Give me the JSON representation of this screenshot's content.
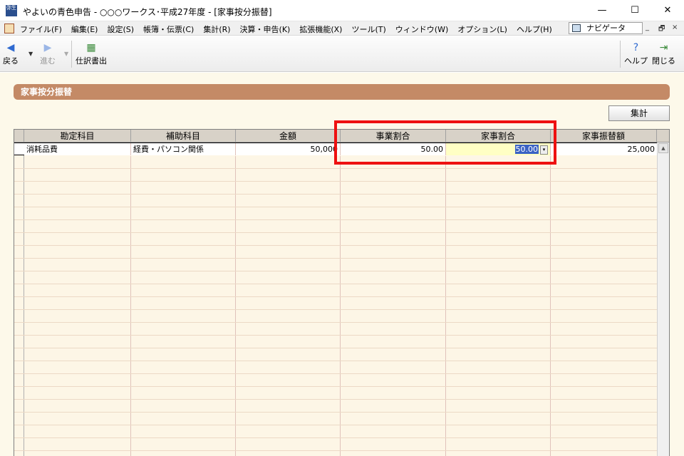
{
  "window": {
    "title": "やよいの青色申告 - ○○○ワークス･平成27年度 - [家事按分振替]",
    "app_icon_text": "弥生",
    "controls": {
      "minimize": "—",
      "maximize": "☐",
      "close": "✕"
    }
  },
  "menu": {
    "items": [
      "ファイル(F)",
      "編集(E)",
      "設定(S)",
      "帳簿・伝票(C)",
      "集計(R)",
      "決算・申告(K)",
      "拡張機能(X)",
      "ツール(T)",
      "ウィンドウ(W)",
      "オプション(L)",
      "ヘルプ(H)"
    ],
    "navigator_label": "ナビゲータ",
    "mdi": {
      "minimize": "_",
      "restore": "🗗",
      "close": "×"
    }
  },
  "toolbar": {
    "back_label": "戻る",
    "forward_label": "進む",
    "journal_label": "仕訳書出",
    "help_label": "ヘルプ",
    "close_label": "閉じる"
  },
  "section": {
    "title": "家事按分振替"
  },
  "buttons": {
    "total_label": "集計"
  },
  "grid": {
    "columns": [
      "勘定科目",
      "補助科目",
      "金額",
      "事業割合",
      "家事割合",
      "家事振替額"
    ],
    "rows": [
      {
        "account": "消耗品費",
        "sub_account": "経費・パソコン関係",
        "amount": "50,000",
        "business_ratio": "50.00",
        "household_ratio": "50.00",
        "household_transfer": "25,000"
      }
    ]
  },
  "colors": {
    "accent": "#c48a66",
    "highlight": "#ee1111",
    "edit_cell": "#ffffc4"
  }
}
